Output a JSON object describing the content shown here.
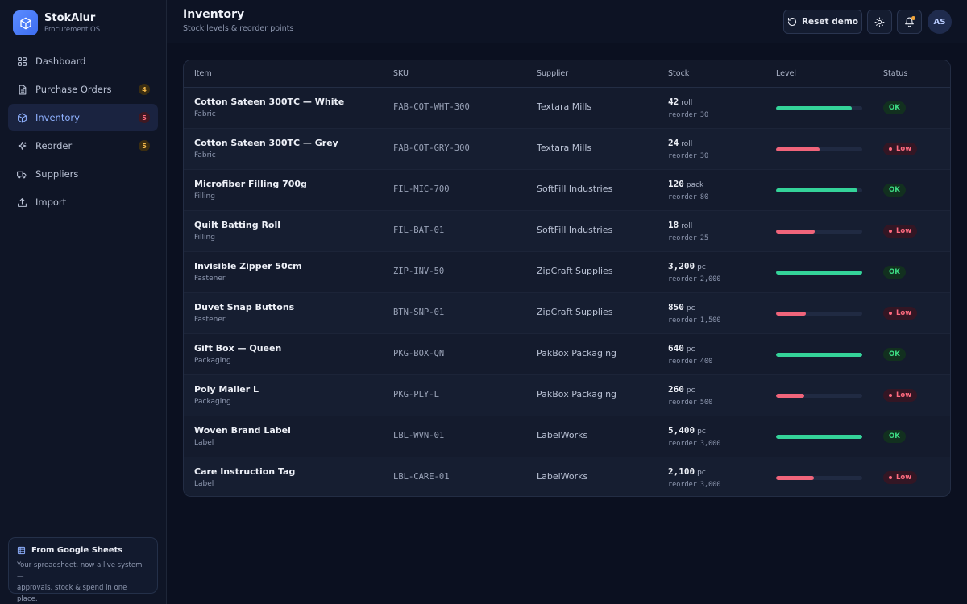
{
  "app": {
    "name": "StokAlur",
    "subtitle": "Procurement OS"
  },
  "nav": [
    {
      "label": "Dashboard",
      "icon": "grid-icon",
      "badge": null,
      "active": false
    },
    {
      "label": "Purchase Orders",
      "icon": "document-icon",
      "badge": "4",
      "badge_color": "amber",
      "active": false
    },
    {
      "label": "Inventory",
      "icon": "box-icon",
      "badge": "5",
      "badge_color": "red",
      "active": true
    },
    {
      "label": "Reorder",
      "icon": "sparkle-icon",
      "badge": "5",
      "badge_color": "amber",
      "active": false
    },
    {
      "label": "Suppliers",
      "icon": "truck-icon",
      "badge": null,
      "active": false
    },
    {
      "label": "Import",
      "icon": "upload-icon",
      "badge": null,
      "active": false
    }
  ],
  "promo": {
    "title": "From Google Sheets",
    "line1": "Your spreadsheet, now a live system —",
    "line2": "approvals, stock & spend in one place."
  },
  "header": {
    "title": "Inventory",
    "subtitle": "Stock levels & reorder points",
    "reset_label": "Reset demo",
    "avatar_initials": "AS"
  },
  "table": {
    "columns": [
      "Item",
      "SKU",
      "Supplier",
      "Stock",
      "Level",
      "Status"
    ],
    "reorder_label": "reorder",
    "rows": [
      {
        "name": "Cotton Sateen 300TC — White",
        "category": "Fabric",
        "sku": "FAB-COT-WHT-300",
        "supplier": "Textara Mills",
        "stock": "42",
        "unit": "roll",
        "reorder": "30",
        "level": 0.88,
        "status": "OK"
      },
      {
        "name": "Cotton Sateen 300TC — Grey",
        "category": "Fabric",
        "sku": "FAB-COT-GRY-300",
        "supplier": "Textara Mills",
        "stock": "24",
        "unit": "roll",
        "reorder": "30",
        "level": 0.5,
        "status": "Low"
      },
      {
        "name": "Microfiber Filling 700g",
        "category": "Filling",
        "sku": "FIL-MIC-700",
        "supplier": "SoftFill Industries",
        "stock": "120",
        "unit": "pack",
        "reorder": "80",
        "level": 0.94,
        "status": "OK"
      },
      {
        "name": "Quilt Batting Roll",
        "category": "Filling",
        "sku": "FIL-BAT-01",
        "supplier": "SoftFill Industries",
        "stock": "18",
        "unit": "roll",
        "reorder": "25",
        "level": 0.45,
        "status": "Low"
      },
      {
        "name": "Invisible Zipper 50cm",
        "category": "Fastener",
        "sku": "ZIP-INV-50",
        "supplier": "ZipCraft Supplies",
        "stock": "3,200",
        "unit": "pc",
        "reorder": "2,000",
        "level": 1.0,
        "status": "OK"
      },
      {
        "name": "Duvet Snap Buttons",
        "category": "Fastener",
        "sku": "BTN-SNP-01",
        "supplier": "ZipCraft Supplies",
        "stock": "850",
        "unit": "pc",
        "reorder": "1,500",
        "level": 0.35,
        "status": "Low"
      },
      {
        "name": "Gift Box — Queen",
        "category": "Packaging",
        "sku": "PKG-BOX-QN",
        "supplier": "PakBox Packaging",
        "stock": "640",
        "unit": "pc",
        "reorder": "400",
        "level": 1.0,
        "status": "OK"
      },
      {
        "name": "Poly Mailer L",
        "category": "Packaging",
        "sku": "PKG-PLY-L",
        "supplier": "PakBox Packaging",
        "stock": "260",
        "unit": "pc",
        "reorder": "500",
        "level": 0.33,
        "status": "Low"
      },
      {
        "name": "Woven Brand Label",
        "category": "Label",
        "sku": "LBL-WVN-01",
        "supplier": "LabelWorks",
        "stock": "5,400",
        "unit": "pc",
        "reorder": "3,000",
        "level": 1.0,
        "status": "OK"
      },
      {
        "name": "Care Instruction Tag",
        "category": "Label",
        "sku": "LBL-CARE-01",
        "supplier": "LabelWorks",
        "stock": "2,100",
        "unit": "pc",
        "reorder": "3,000",
        "level": 0.44,
        "status": "Low"
      }
    ]
  },
  "colors": {
    "accent": "#5b8cff",
    "ok": "#34d399",
    "low": "#f0647a",
    "background": "#0b1020"
  }
}
